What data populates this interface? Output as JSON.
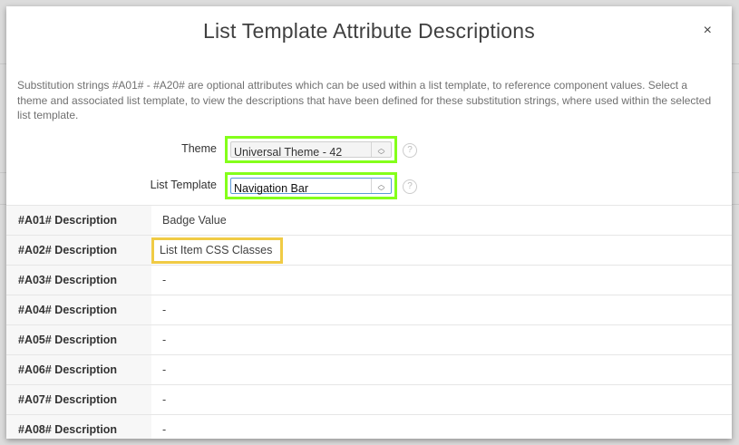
{
  "dialog": {
    "title": "List Template Attribute Descriptions",
    "close_label": "×",
    "description": "Substitution strings #A01# - #A20# are optional attributes which can be used within a list template, to reference component values. Select a theme and associated list template, to view the descriptions that have been defined for these substitution strings, where used within the selected list template.",
    "fields": [
      {
        "label": "Theme",
        "value": "Universal Theme - 42"
      },
      {
        "label": "List Template",
        "value": "Navigation Bar"
      }
    ],
    "help_icon": "?",
    "rows": [
      {
        "key": "#A01# Description",
        "value": "Badge Value"
      },
      {
        "key": "#A02# Description",
        "value": "List Item CSS Classes"
      },
      {
        "key": "#A03# Description",
        "value": "-"
      },
      {
        "key": "#A04# Description",
        "value": "-"
      },
      {
        "key": "#A05# Description",
        "value": "-"
      },
      {
        "key": "#A06# Description",
        "value": "-"
      },
      {
        "key": "#A07# Description",
        "value": "-"
      },
      {
        "key": "#A08# Description",
        "value": "-"
      }
    ]
  },
  "colors": {
    "highlight_green": "#84ff1a",
    "highlight_yellow": "#f0cb45"
  }
}
